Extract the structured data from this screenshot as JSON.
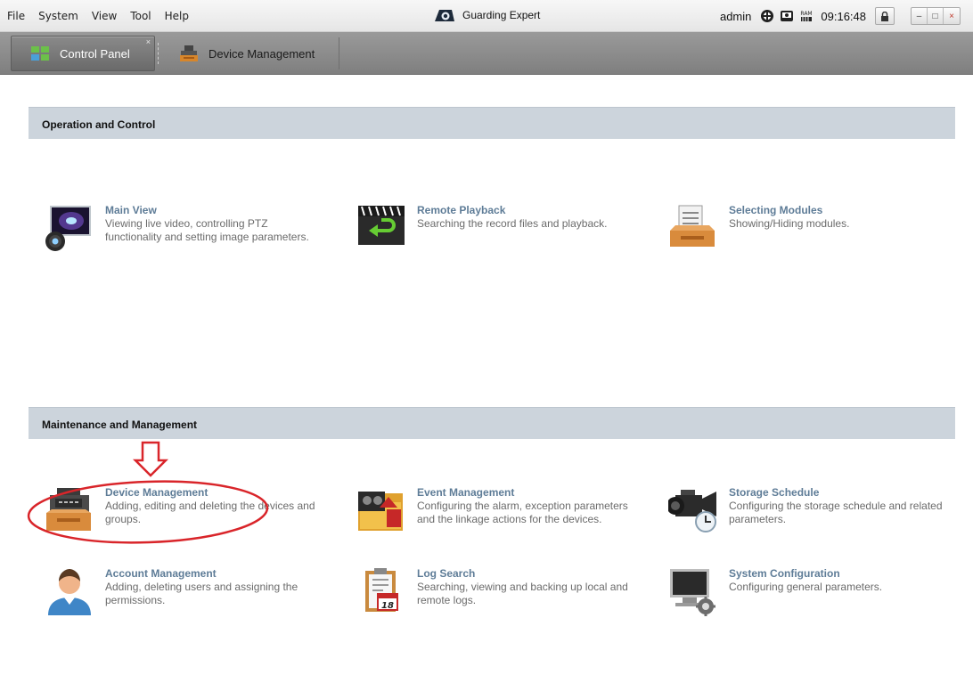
{
  "menu": [
    "File",
    "System",
    "View",
    "Tool",
    "Help"
  ],
  "app_title": "Guarding Expert",
  "status": {
    "user": "admin",
    "time": "09:16:48",
    "icons": [
      "network-icon",
      "hdd-icon",
      "ram-icon",
      "lock-icon"
    ],
    "ram_label": "RAM"
  },
  "window_buttons": [
    "–",
    "□",
    "×"
  ],
  "tabs": [
    {
      "label": "Control Panel",
      "icon": "control-panel-icon",
      "active": true,
      "close": "×"
    },
    {
      "label": "Device Management",
      "icon": "device-management-icon",
      "active": false
    }
  ],
  "sections": [
    {
      "title": "Operation and Control",
      "modules": [
        {
          "title": "Main View",
          "desc": "Viewing live video, controlling PTZ functionality and setting image parameters.",
          "icon": "main-view-icon"
        },
        {
          "title": "Remote Playback",
          "desc": "Searching the record files and playback.",
          "icon": "remote-playback-icon"
        },
        {
          "title": "Selecting Modules",
          "desc": "Showing/Hiding modules.",
          "icon": "selecting-modules-icon"
        }
      ]
    },
    {
      "title": "Maintenance and Management",
      "modules": [
        {
          "title": "Device Management",
          "desc": "Adding, editing and deleting the devices and groups.",
          "icon": "device-management-icon"
        },
        {
          "title": "Event Management",
          "desc": "Configuring the alarm, exception parameters and the linkage actions for the devices.",
          "icon": "event-management-icon"
        },
        {
          "title": "Storage Schedule",
          "desc": "Configuring the storage schedule and related parameters.",
          "icon": "storage-schedule-icon"
        },
        {
          "title": "Account Management",
          "desc": "Adding, deleting users and assigning the permissions.",
          "icon": "account-management-icon"
        },
        {
          "title": "Log Search",
          "desc": "Searching, viewing and backing up local and remote logs.",
          "icon": "log-search-icon"
        },
        {
          "title": "System Configuration",
          "desc": "Configuring general parameters.",
          "icon": "system-configuration-icon"
        }
      ]
    }
  ],
  "log_calendar_day": "18",
  "colors": {
    "module_title": "#5e7c97",
    "section_bg": "#ccd4dc",
    "annotation": "#d9252a"
  }
}
